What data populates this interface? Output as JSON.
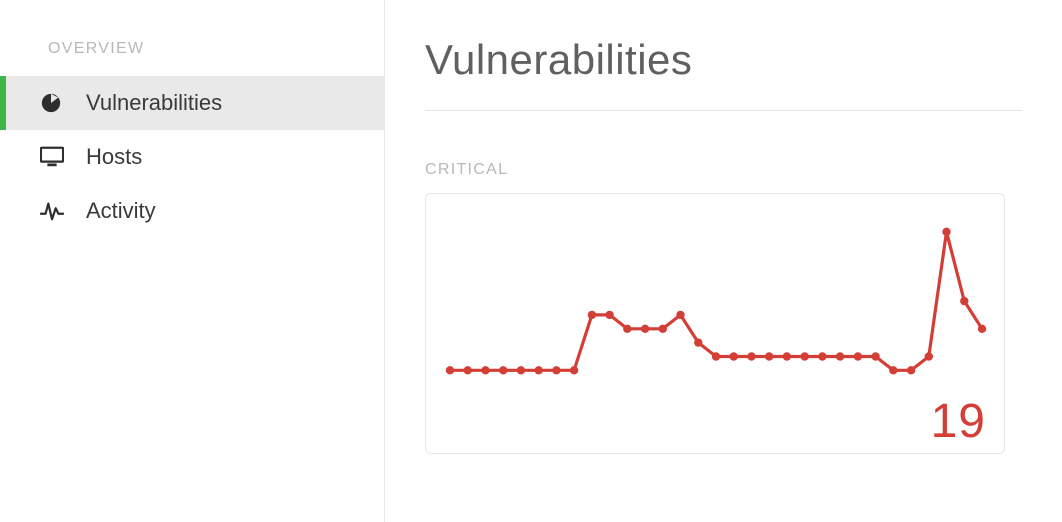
{
  "sidebar": {
    "header": "OVERVIEW",
    "items": [
      {
        "label": "Vulnerabilities",
        "icon": "pie-chart-icon",
        "active": true
      },
      {
        "label": "Hosts",
        "icon": "monitor-icon",
        "active": false
      },
      {
        "label": "Activity",
        "icon": "pulse-icon",
        "active": false
      }
    ]
  },
  "main": {
    "title": "Vulnerabilities",
    "chart": {
      "label": "CRITICAL",
      "value": "19",
      "color": "#d33f37"
    }
  },
  "chart_data": {
    "type": "line",
    "title": "CRITICAL",
    "xlabel": "",
    "ylabel": "",
    "ylim": [
      14,
      27
    ],
    "x": [
      1,
      2,
      3,
      4,
      5,
      6,
      7,
      8,
      9,
      10,
      11,
      12,
      13,
      14,
      15,
      16,
      17,
      18,
      19,
      20,
      21,
      22,
      23,
      24,
      25,
      26,
      27,
      28,
      29,
      30,
      31
    ],
    "values": [
      16,
      16,
      16,
      16,
      16,
      16,
      16,
      16,
      20,
      20,
      19,
      19,
      19,
      20,
      18,
      17,
      17,
      17,
      17,
      17,
      17,
      17,
      17,
      17,
      17,
      16,
      16,
      17,
      26,
      21,
      19
    ],
    "latest": 19
  }
}
